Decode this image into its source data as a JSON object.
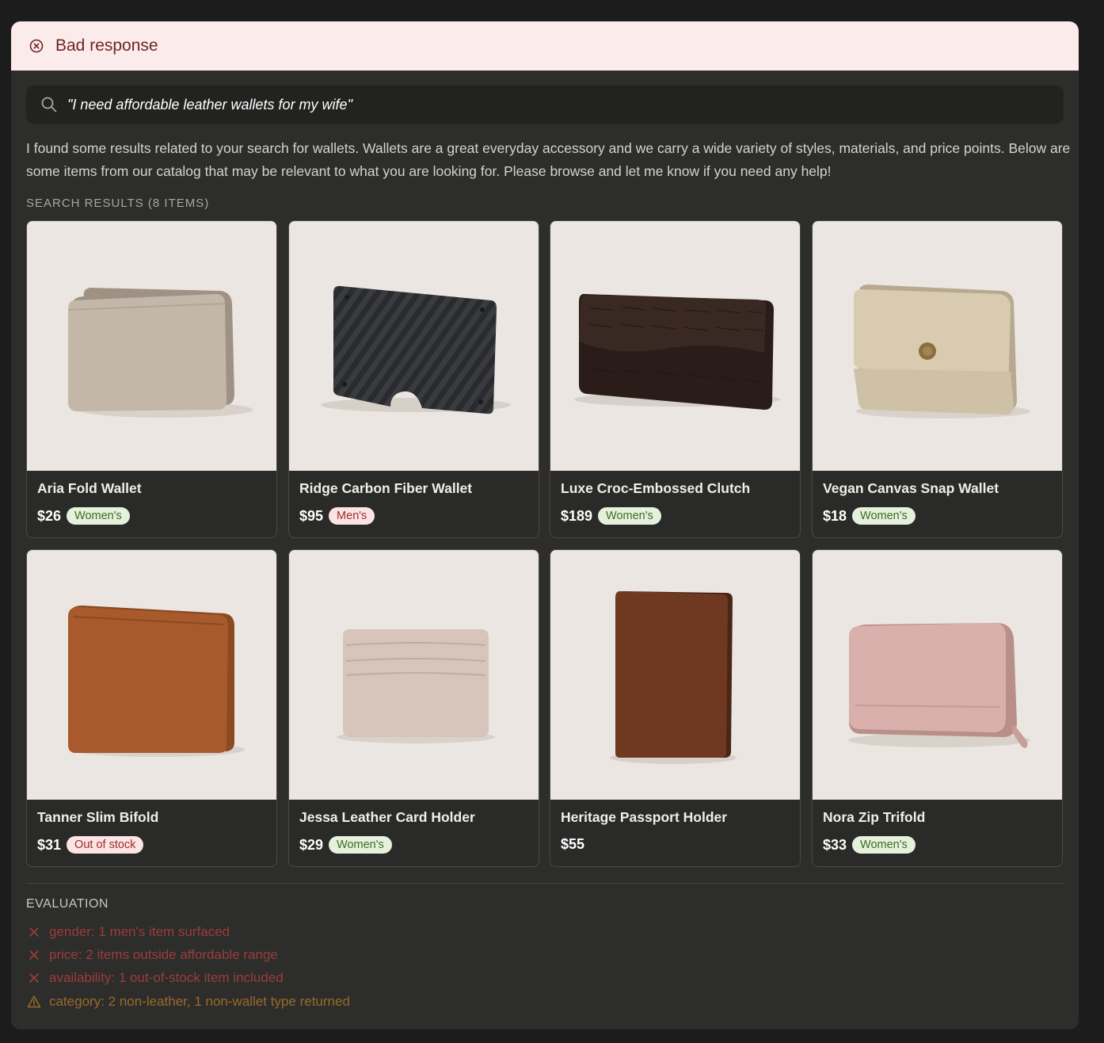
{
  "header": {
    "title": "Bad response",
    "icon": "x-circle-icon"
  },
  "search": {
    "query": "\"I need affordable leather wallets for my wife\"",
    "icon": "search-icon"
  },
  "intro": "I found some results related to your search for wallets. Wallets are a great everyday accessory and we carry a wide variety of styles, materials, and price points. Below are some items from our catalog that may be relevant to what you are looking for. Please browse and let me know if you need any help!",
  "results_label": "SEARCH RESULTS (8 ITEMS)",
  "products": [
    {
      "name": "Aria Fold Wallet",
      "price": "$26",
      "badge": "Women's",
      "badge_type": "women"
    },
    {
      "name": "Ridge Carbon Fiber Wallet",
      "price": "$95",
      "badge": "Men's",
      "badge_type": "men"
    },
    {
      "name": "Luxe Croc-Embossed Clutch",
      "price": "$189",
      "badge": "Women's",
      "badge_type": "women"
    },
    {
      "name": "Vegan Canvas Snap Wallet",
      "price": "$18",
      "badge": "Women's",
      "badge_type": "women"
    },
    {
      "name": "Tanner Slim Bifold",
      "price": "$31",
      "badge": "Out of stock",
      "badge_type": "oos"
    },
    {
      "name": "Jessa Leather Card Holder",
      "price": "$29",
      "badge": "Women's",
      "badge_type": "women"
    },
    {
      "name": "Heritage Passport Holder",
      "price": "$55",
      "badge": "",
      "badge_type": ""
    },
    {
      "name": "Nora Zip Trifold",
      "price": "$33",
      "badge": "Women's",
      "badge_type": "women"
    }
  ],
  "evaluation": {
    "title": "EVALUATION",
    "items": [
      {
        "status": "fail",
        "icon": "x-icon",
        "text": "gender: 1 men's item surfaced"
      },
      {
        "status": "fail",
        "icon": "x-icon",
        "text": "price: 2 items outside affordable range"
      },
      {
        "status": "fail",
        "icon": "x-icon",
        "text": "availability: 1 out-of-stock item included"
      },
      {
        "status": "warn",
        "icon": "warning-triangle-icon",
        "text": "category: 2 non-leather, 1 non-wallet type returned"
      }
    ]
  },
  "colors": {
    "header_bg": "#fbeceb",
    "header_text": "#6d2424",
    "women_badge_bg": "#e5f1dc",
    "women_badge_text": "#3e6a24",
    "alert_badge_bg": "#fbe5e4",
    "alert_badge_text": "#9c2b2b",
    "fail": "#9b3d3a",
    "warn": "#9b6a2a"
  }
}
